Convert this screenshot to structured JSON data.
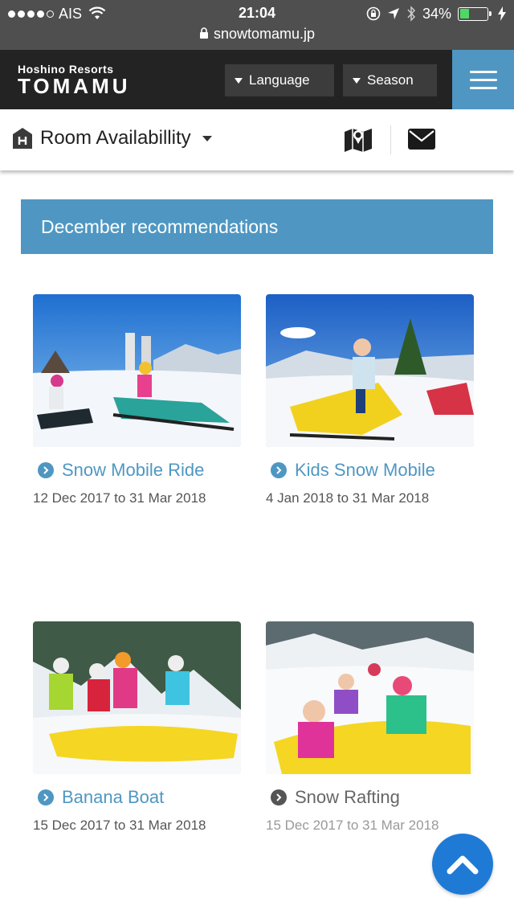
{
  "status_bar": {
    "carrier": "AIS",
    "time": "21:04",
    "battery": "34%",
    "battery_level": 0.34,
    "url": "snowtomamu.jp",
    "icons": [
      "signal-dots",
      "wifi-icon",
      "lock-rotation-icon",
      "location-icon",
      "bluetooth-icon",
      "battery-icon",
      "charging-icon",
      "lock-icon"
    ]
  },
  "header": {
    "logo_top": "Hoshino Resorts",
    "logo_main": "TOMAMU",
    "language_label": "Language",
    "season_label": "Season",
    "menu_icon": "hamburger-menu-icon"
  },
  "subnav": {
    "rooms_label": "Room Availabillity",
    "icons": [
      "hotel-icon",
      "map-icon",
      "mail-icon"
    ]
  },
  "section": {
    "title": "December recommendations"
  },
  "activities": [
    {
      "title": "Snow Mobile Ride",
      "dates": "12 Dec 2017 to 31 Mar 2018"
    },
    {
      "title": "Kids Snow Mobile",
      "dates": "4 Jan 2018 to 31 Mar 2018"
    },
    {
      "title": "Banana Boat",
      "dates": "15 Dec 2017 to 31 Mar 2018"
    },
    {
      "title": "Snow Rafting",
      "dates": "15 Dec 2017 to 31 Mar 2018"
    }
  ],
  "colors": {
    "accent": "#4f97c2",
    "header_bg": "#232323",
    "status_bg": "#4f4f4f",
    "top_button": "#1f7ad6"
  },
  "back_to_top_icon": "chevron-up-icon"
}
